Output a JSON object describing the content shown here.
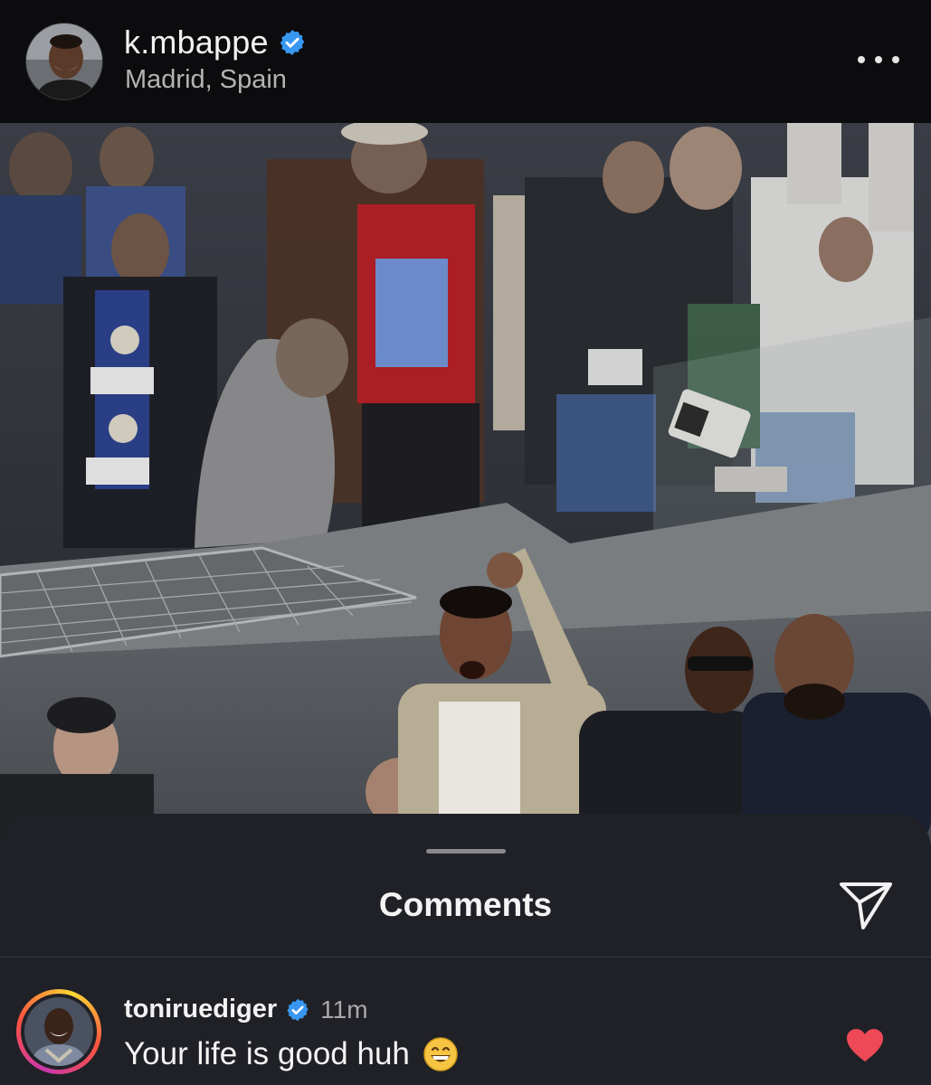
{
  "header": {
    "username": "k.mbappe",
    "location": "Madrid, Spain",
    "verified_icon": "verified-badge-icon",
    "more_icon": "more-horizontal-icon"
  },
  "post": {
    "image_description_icon": "stadium-photo"
  },
  "comments_sheet": {
    "title": "Comments",
    "share_icon": "send-icon",
    "comments": [
      {
        "username": "toniruediger",
        "verified": true,
        "time": "11m",
        "text": "Your life is good huh",
        "emoji": "grinning-face",
        "liked": true
      }
    ]
  },
  "colors": {
    "verified": "#3897f0",
    "heart": "#ed4956",
    "sheet_bg": "#202126",
    "header_bg": "#0c0c0e"
  }
}
